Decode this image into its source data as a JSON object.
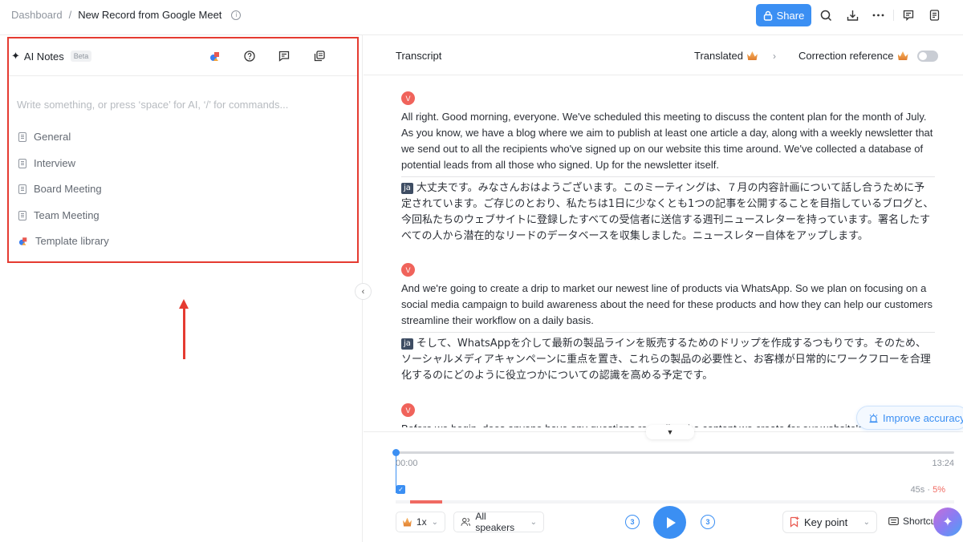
{
  "header": {
    "breadcrumb_home": "Dashboard",
    "breadcrumb_sep": "/",
    "title": "New Record from Google Meet",
    "share_label": "Share",
    "icons": [
      "info-icon",
      "lock-icon",
      "search-icon",
      "download-icon",
      "more-icon",
      "comment-icon",
      "notes-icon"
    ]
  },
  "ai_notes": {
    "title": "AI Notes",
    "badge": "Beta",
    "placeholder": "Write something, or press ‘space’ for AI, ‘/’ for commands...",
    "templates": [
      {
        "label": "General",
        "icon": "doc-icon"
      },
      {
        "label": "Interview",
        "icon": "doc-icon"
      },
      {
        "label": "Board Meeting",
        "icon": "doc-icon"
      },
      {
        "label": "Team Meeting",
        "icon": "doc-icon"
      },
      {
        "label": "Template library",
        "icon": "template-library-icon"
      }
    ],
    "collapse_glyph": "‹"
  },
  "transcript": {
    "title": "Transcript",
    "translated_label": "Translated",
    "translated_chevron": "›",
    "correction_label": "Correction reference",
    "correction_enabled": false,
    "lang_tag": "ja",
    "segments": [
      {
        "speaker_initial": "V",
        "text": "All right. Good morning, everyone. We've scheduled this meeting to discuss the content plan for the month of July. As you know, we have a blog where we aim to publish at least one article a day, along with a weekly newsletter that we send out to all the recipients who've signed up on our website this time around. We've collected a database of potential leads from all those who signed. Up for the newsletter itself.",
        "translation": "大丈夫です。みなさんおはようございます。このミーティングは、７月の内容計画について話し合うために予定されています。ご存じのとおり、私たちは1日に少なくとも1つの記事を公開することを目指しているブログと、今回私たちのウェブサイトに登録したすべての受信者に送信する週刊ニュースレターを持っています。署名したすべての人から潜在的なリードのデータベースを収集しました。ニュースレター自体をアップします。"
      },
      {
        "speaker_initial": "V",
        "text": "And we're going to create a drip to market our newest line of products via WhatsApp. So we plan on focusing on a social media campaign to build awareness about the need for these products and how they can help our customers streamline their workflow on a daily basis.",
        "translation": "そして、WhatsAppを介して最新の製品ラインを販売するためのドリップを作成するつもりです。そのため、ソーシャルメディアキャンペーンに重点を置き、これらの製品の必要性と、お客様が日常的にワークフローを合理化するのにどのように役立つかについての認識を高める予定です。"
      },
      {
        "speaker_initial": "V",
        "text": "Before we begin, does anyone have any questions regarding the content we create for our website's blog? If not"
      }
    ],
    "improve_label": "Improve accuracy",
    "scroll_down_glyph": "▼"
  },
  "player": {
    "current_time": "00:00",
    "total_time": "13:24",
    "progress": 0,
    "speaker_duration": "45s",
    "speaker_sep": " · ",
    "speaker_percent": "5%",
    "speed": "1x",
    "speakers_label": "All speakers",
    "skip_back_seconds": "3",
    "skip_forward_seconds": "3",
    "keypoint_label": "Key point",
    "shortcut_label": "Shortcu",
    "accent_color": "#3b8ff3",
    "speaker_color": "#f06a62"
  }
}
